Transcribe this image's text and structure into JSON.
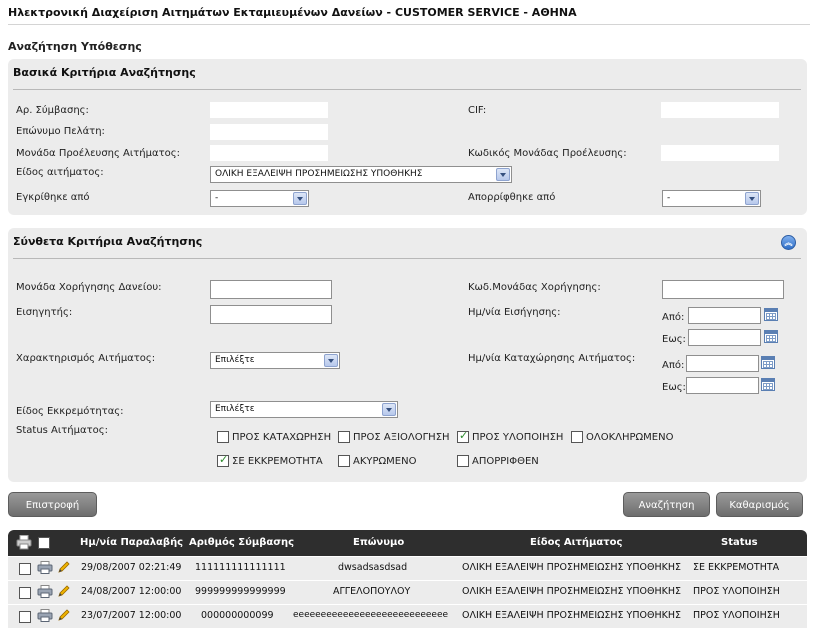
{
  "app": {
    "title": "Ηλεκτρονική Διαχείριση Αιτημάτων Εκταμιευμένων Δανείων - CUSTOMER SERVICE - ΑΘΗΝΑ"
  },
  "page": {
    "title": "Αναζήτηση Υπόθεσης"
  },
  "basic": {
    "title": "Βασικά Κριτήρια Αναζήτησης",
    "contract_label": "Αρ. Σύμβασης:",
    "contract_value": "",
    "cif_label": "CIF:",
    "cif_value": "",
    "surname_label": "Επώνυμο Πελάτη:",
    "surname_value": "",
    "origin_unit_label": "Μονάδα Προέλευσης Αιτήματος:",
    "origin_unit_value": "",
    "origin_code_label": "Κωδικός Μονάδας Προέλευσης:",
    "origin_code_value": "",
    "request_type_label": "Είδος αιτήματος:",
    "request_type_value": "ΟΛΙΚΗ ΕΞΑΛΕΙΨΗ ΠΡΟΣΗΜΕΙΩΣΗΣ ΥΠΟΘΗΚΗΣ",
    "approved_label": "Εγκρίθηκε από",
    "approved_value": "-",
    "rejected_label": "Απορρίφθηκε από",
    "rejected_value": "-"
  },
  "complex": {
    "title": "Σύνθετα Κριτήρια Αναζήτησης",
    "grant_unit_label": "Μονάδα Χορήγησης Δανείου:",
    "grant_unit_value": "",
    "grant_code_label": "Κωδ.Μονάδας Χορήγησης:",
    "grant_code_value": "",
    "proposer_label": "Εισηγητής:",
    "proposer_value": "",
    "proposal_date_label": "Ημ/νία Εισήγησης:",
    "from_label": "Από:",
    "to_label": "Εως:",
    "characterization_label": "Χαρακτηρισμός Αιτήματος:",
    "characterization_value": "Επιλέξτε",
    "registration_date_label": "Ημ/νία Καταχώρησης Αιτήματος:",
    "pending_type_label": "Είδος Εκκρεμότητας:",
    "pending_type_value": "Επιλέξτε",
    "status_label": "Status Αιτήματος:",
    "statuses": [
      {
        "label": "ΠΡΟΣ ΚΑΤΑΧΩΡΗΣΗ",
        "checked": false
      },
      {
        "label": "ΠΡΟΣ ΑΞΙΟΛΟΓΗΣΗ",
        "checked": false
      },
      {
        "label": "ΠΡΟΣ ΥΛΟΠΟΙΗΣΗ",
        "checked": true
      },
      {
        "label": "ΟΛΟΚΛΗΡΩΜΕΝΟ",
        "checked": false
      },
      {
        "label": "ΣΕ ΕΚΚΡΕΜΟΤΗΤΑ",
        "checked": true
      },
      {
        "label": "ΑΚΥΡΩΜΕΝΟ",
        "checked": false
      },
      {
        "label": "ΑΠΟΡΡΙΦΘΕΝ",
        "checked": false
      }
    ]
  },
  "buttons": {
    "back": "Επιστροφή",
    "search": "Αναζήτηση",
    "clear": "Καθαρισμός"
  },
  "grid": {
    "headers": [
      "Ημ/νία Παραλαβής",
      "Αριθμός Σύμβασης",
      "Επώνυμο",
      "Είδος Αιτήματος",
      "Status"
    ],
    "rows": [
      {
        "date": "29/08/2007 02:21:49",
        "contract": "111111111111111",
        "surname": "dwsadsasdsad",
        "type": "ΟΛΙΚΗ ΕΞΑΛΕΙΨΗ ΠΡΟΣΗΜΕΙΩΣΗΣ ΥΠΟΘΗΚΗΣ",
        "status": "ΣΕ ΕΚΚΡΕΜΟΤΗΤΑ"
      },
      {
        "date": "24/08/2007 12:00:00",
        "contract": "999999999999999",
        "surname": "ΑΓΓΕΛΟΠΟΥΛΟΥ",
        "type": "ΟΛΙΚΗ ΕΞΑΛΕΙΨΗ ΠΡΟΣΗΜΕΙΩΣΗΣ ΥΠΟΘΗΚΗΣ",
        "status": "ΠΡΟΣ ΥΛΟΠΟΙΗΣΗ"
      },
      {
        "date": "23/07/2007 12:00:00",
        "contract": "000000000099",
        "surname": "eeeeeeeeeeeeeeeeeeeeeeeeeeee",
        "type": "ΟΛΙΚΗ ΕΞΑΛΕΙΨΗ ΠΡΟΣΗΜΕΙΩΣΗΣ ΥΠΟΘΗΚΗΣ",
        "status": "ΠΡΟΣ ΥΛΟΠΟΙΗΣΗ"
      }
    ]
  },
  "icons": {
    "print": "printer-icon",
    "edit": "pencil-icon",
    "collapse": "collapse-up-icon",
    "calendar": "calendar-icon"
  }
}
